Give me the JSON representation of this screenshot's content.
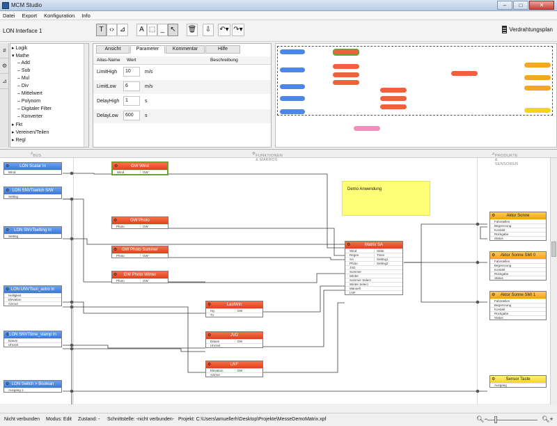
{
  "window": {
    "title": "MCM Studio",
    "minimize": "–",
    "maximize": "□",
    "close": "✕"
  },
  "menu": [
    "Datei",
    "Export",
    "Konfiguration",
    "Info"
  ],
  "toolbar": {
    "document": "LON Interface 1",
    "verdrahtungsplan": "Verdrahtungsplan"
  },
  "tree": [
    {
      "label": "Logik",
      "arrow": "▸"
    },
    {
      "label": "Mathe",
      "arrow": "▾"
    },
    {
      "label": "Add",
      "arrow": "▸"
    },
    {
      "label": "Sub",
      "arrow": "▸"
    },
    {
      "label": "Mul",
      "arrow": "▸"
    },
    {
      "label": "Div",
      "arrow": "▸"
    },
    {
      "label": "Mittelwert",
      "arrow": "▸"
    },
    {
      "label": "Polynom",
      "arrow": "▸"
    },
    {
      "label": "Digitaler Filter",
      "arrow": "▸"
    },
    {
      "label": "Konverter",
      "arrow": "▸"
    },
    {
      "label": "Fkt",
      "arrow": "▸"
    },
    {
      "label": "Vereinen/Teilen",
      "arrow": "▸"
    },
    {
      "label": "Regl",
      "arrow": "▸"
    }
  ],
  "props": {
    "tabs": [
      "Ansicht",
      "Parameter",
      "Kommentar",
      "Hilfe"
    ],
    "headers": {
      "alias": "Alias-Name",
      "wert": "Wert",
      "beschreibung": "Beschreibung"
    },
    "rows": [
      {
        "name": "LimitHigh",
        "value": "10",
        "unit": "m/s"
      },
      {
        "name": "LimitLow",
        "value": "6",
        "unit": "m/s"
      },
      {
        "name": "DelayHigh",
        "value": "1",
        "unit": "s"
      },
      {
        "name": "DelayLow",
        "value": "600",
        "unit": "s"
      }
    ]
  },
  "columns": {
    "bus": "BUS",
    "funktionen": "FUNKTIONEN & MAKROS",
    "produkte": "PRODUKTE & SENSOREN"
  },
  "note": "Demo Anwendung",
  "nodes": {
    "n1": {
      "title": "LON Scalar In",
      "rows": [
        [
          "Wind",
          ""
        ]
      ]
    },
    "n2": {
      "title": "LON SNVTswitch S/W",
      "rows": [
        [
          "Setting",
          ""
        ]
      ]
    },
    "n3": {
      "title": "LON SNVTsetting In",
      "rows": [
        [
          "Setting",
          ""
        ]
      ]
    },
    "n4": {
      "title": "LON UNVTsun_astro In",
      "rows": [
        [
          "Helligkeit",
          ""
        ],
        [
          "Elevation",
          ""
        ],
        [
          "Azimut",
          ""
        ]
      ]
    },
    "n5": {
      "title": "LON SNVTtime_stamp In",
      "rows": [
        [
          "Datum",
          ""
        ],
        [
          "Uhrzeit",
          ""
        ]
      ]
    },
    "n6": {
      "title": "LON Switch > Boolean",
      "rows": [
        [
          "Ausgang 1",
          ""
        ]
      ]
    },
    "gw1": {
      "title": "GW Wind",
      "rows": [
        [
          "Wind",
          "GW"
        ]
      ]
    },
    "gw2": {
      "title": "GW Photo",
      "rows": [
        [
          "Photo",
          "GW"
        ]
      ]
    },
    "gw3": {
      "title": "GW Photo Summer",
      "rows": [
        [
          "Photo",
          "GW"
        ]
      ]
    },
    "gw4": {
      "title": "GW Photo Winter",
      "rows": [
        [
          "Photo",
          "GW"
        ]
      ]
    },
    "lw": {
      "title": "LastWin",
      "rows": [
        [
          "Hg",
          "GW"
        ],
        [
          "T1",
          ""
        ]
      ]
    },
    "jvd": {
      "title": "JVD",
      "rows": [
        [
          "Datum",
          "GW"
        ],
        [
          "Uhrzeit",
          ""
        ]
      ]
    },
    "lnf": {
      "title": "LNF",
      "rows": [
        [
          "Elevation",
          "GW"
        ],
        [
          "Azimut",
          ""
        ]
      ]
    },
    "msa": {
      "title": "Matrix SA",
      "rows": [
        [
          "Wind",
          "State"
        ],
        [
          "Regen",
          "Timer"
        ],
        [
          "SA",
          "Setting1"
        ],
        [
          "Photo",
          "Setting2"
        ],
        [
          "JVD",
          ""
        ],
        [
          "Sommer",
          ""
        ],
        [
          "Winter",
          ""
        ],
        [
          "Sommer Select",
          ""
        ],
        [
          "Winter Select",
          ""
        ],
        [
          "Manuell",
          ""
        ],
        [
          "LNF",
          ""
        ]
      ]
    },
    "a1": {
      "title": "Aktor Sonne",
      "rows": [
        [
          "Fahrstellen",
          ""
        ],
        [
          "Begrenzung",
          ""
        ],
        [
          "Kontakt",
          ""
        ],
        [
          "Rückgabe",
          ""
        ],
        [
          "Status",
          ""
        ]
      ]
    },
    "a2": {
      "title": "Aktor Sonne SMI 0",
      "rows": [
        [
          "Fahrstellen",
          ""
        ],
        [
          "Begrenzung",
          ""
        ],
        [
          "Kontakt",
          ""
        ],
        [
          "Rückgabe",
          ""
        ],
        [
          "Status",
          ""
        ]
      ]
    },
    "a3": {
      "title": "Aktor Sonne SMI 1",
      "rows": [
        [
          "Fahrstellen",
          ""
        ],
        [
          "Begrenzung",
          ""
        ],
        [
          "Kontakt",
          ""
        ],
        [
          "Rückgabe",
          ""
        ],
        [
          "Status",
          ""
        ]
      ]
    },
    "st": {
      "title": "Sensor Taste",
      "rows": [
        [
          "Ausgang",
          ""
        ]
      ]
    }
  },
  "status": {
    "verbindung": "Nicht verbunden",
    "modus": "Modus: Edit",
    "zustand": "Zustand: -",
    "schnittstelle": "Schnittstelle: -nicht verbunden-",
    "projekt": "Projekt:   C:\\Users\\amuellerh\\Desktop\\Projekte\\MesseDemoMatrix.xpf"
  },
  "colors": {
    "blue": "#3a78d6",
    "red": "#e0401c",
    "orange": "#f2a20f",
    "yellow": "#f3d520",
    "note": "#ffff77"
  }
}
